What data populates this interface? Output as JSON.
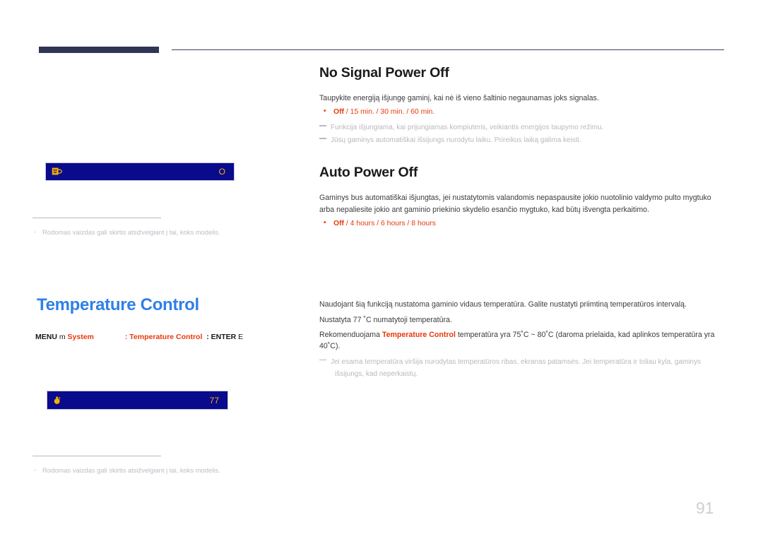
{
  "header": {
    "bar_color": "#2e3555",
    "rule_color": "#3d4260"
  },
  "sections": {
    "no_signal_power_off": {
      "title": "No Signal Power Off",
      "intro": "Taupykite energiją išjungę gaminį, kai nė iš vieno šaltinio negaunamas joks signalas.",
      "option_first": "Off",
      "option_rest": " / 15 min. / 30 min. / 60 min.",
      "notes": [
        "Funkcija išjungiama, kai prijungiamas kompiuteris, veikiantis energijos taupymo režimu.",
        "Jūsų gaminys automatiškai išsijungs nurodytu laiku. Prireikus laiką galima keisti."
      ]
    },
    "auto_power_off": {
      "title": "Auto Power Off",
      "intro": "Gaminys bus automatiškai išjungtas, jei nustatytomis valandomis nepaspausite jokio nuotolinio valdymo pulto mygtuko arba nepaliesite jokio ant gaminio priekinio skydelio esančio mygtuko, kad būtų išvengta perkaitimo.",
      "option_first": "Off",
      "option_rest": " / 4 hours / 6 hours / 8 hours"
    },
    "temperature_control": {
      "panel_title": "Temperature Control",
      "menu_path": {
        "menu_label": "MENU",
        "menu_key": "m",
        "system_label": "System",
        "colon_1": ":",
        "item_label": "Temperature Control",
        "colon_2": ":",
        "enter_label": "ENTER",
        "enter_key": "E"
      },
      "paragraphs": [
        "Naudojant šią funkciją nustatoma gaminio vidaus temperatūra. Galite nustatyti priimtiną temperatūros intervalą.",
        "Nustatyta 77 ˚C numatytoji temperatūra."
      ],
      "recommend_pre": "Rekomenduojama ",
      "recommend_highlight": "Temperature Control",
      "recommend_post": " temperatūra yra 75˚C ~ 80˚C (daroma prielaida, kad aplinkos temperatūra yra 40˚C).",
      "notes": [
        "Jei esama temperatūra viršija nurodytas temperatūros ribas, ekranas patamsės. Jei temperatūra ir toliau kyla, gaminys",
        "išsijungs, kad neperkaistų."
      ]
    }
  },
  "previews": {
    "box_1": {
      "icon": "power-plug-icon",
      "value": "O",
      "bg_color": "#0a0a8c",
      "value_color": "#f2b200"
    },
    "box_2": {
      "icon": "thermometer-icon",
      "value": "77",
      "bg_color": "#0a0a8c",
      "value_color": "#f2b200"
    }
  },
  "footnotes": {
    "note_1": "Rodomas vaizdas gali skirtis atsižvelgiant į tai, koks modelis.",
    "note_2": "Rodomas vaizdas gali skirtis atsižvelgiant į tai, koks modelis."
  },
  "page_number": "91"
}
